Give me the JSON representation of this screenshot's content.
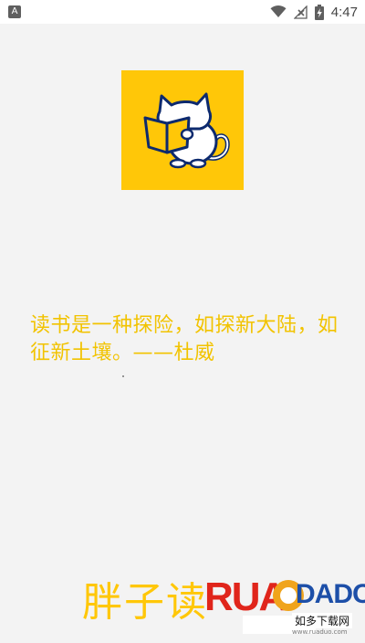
{
  "status_bar": {
    "time": "4:47",
    "left_icon_label": "A"
  },
  "splash": {
    "quote": "读书是一种探险，如探新大陆，如征新土壤。——杜威",
    "app_name": "胖子读",
    "brand_color": "#ffc708"
  },
  "watermark": {
    "brand": "RUADADO",
    "subtitle": "如多下载网",
    "url": "www.ruaduo.com"
  }
}
